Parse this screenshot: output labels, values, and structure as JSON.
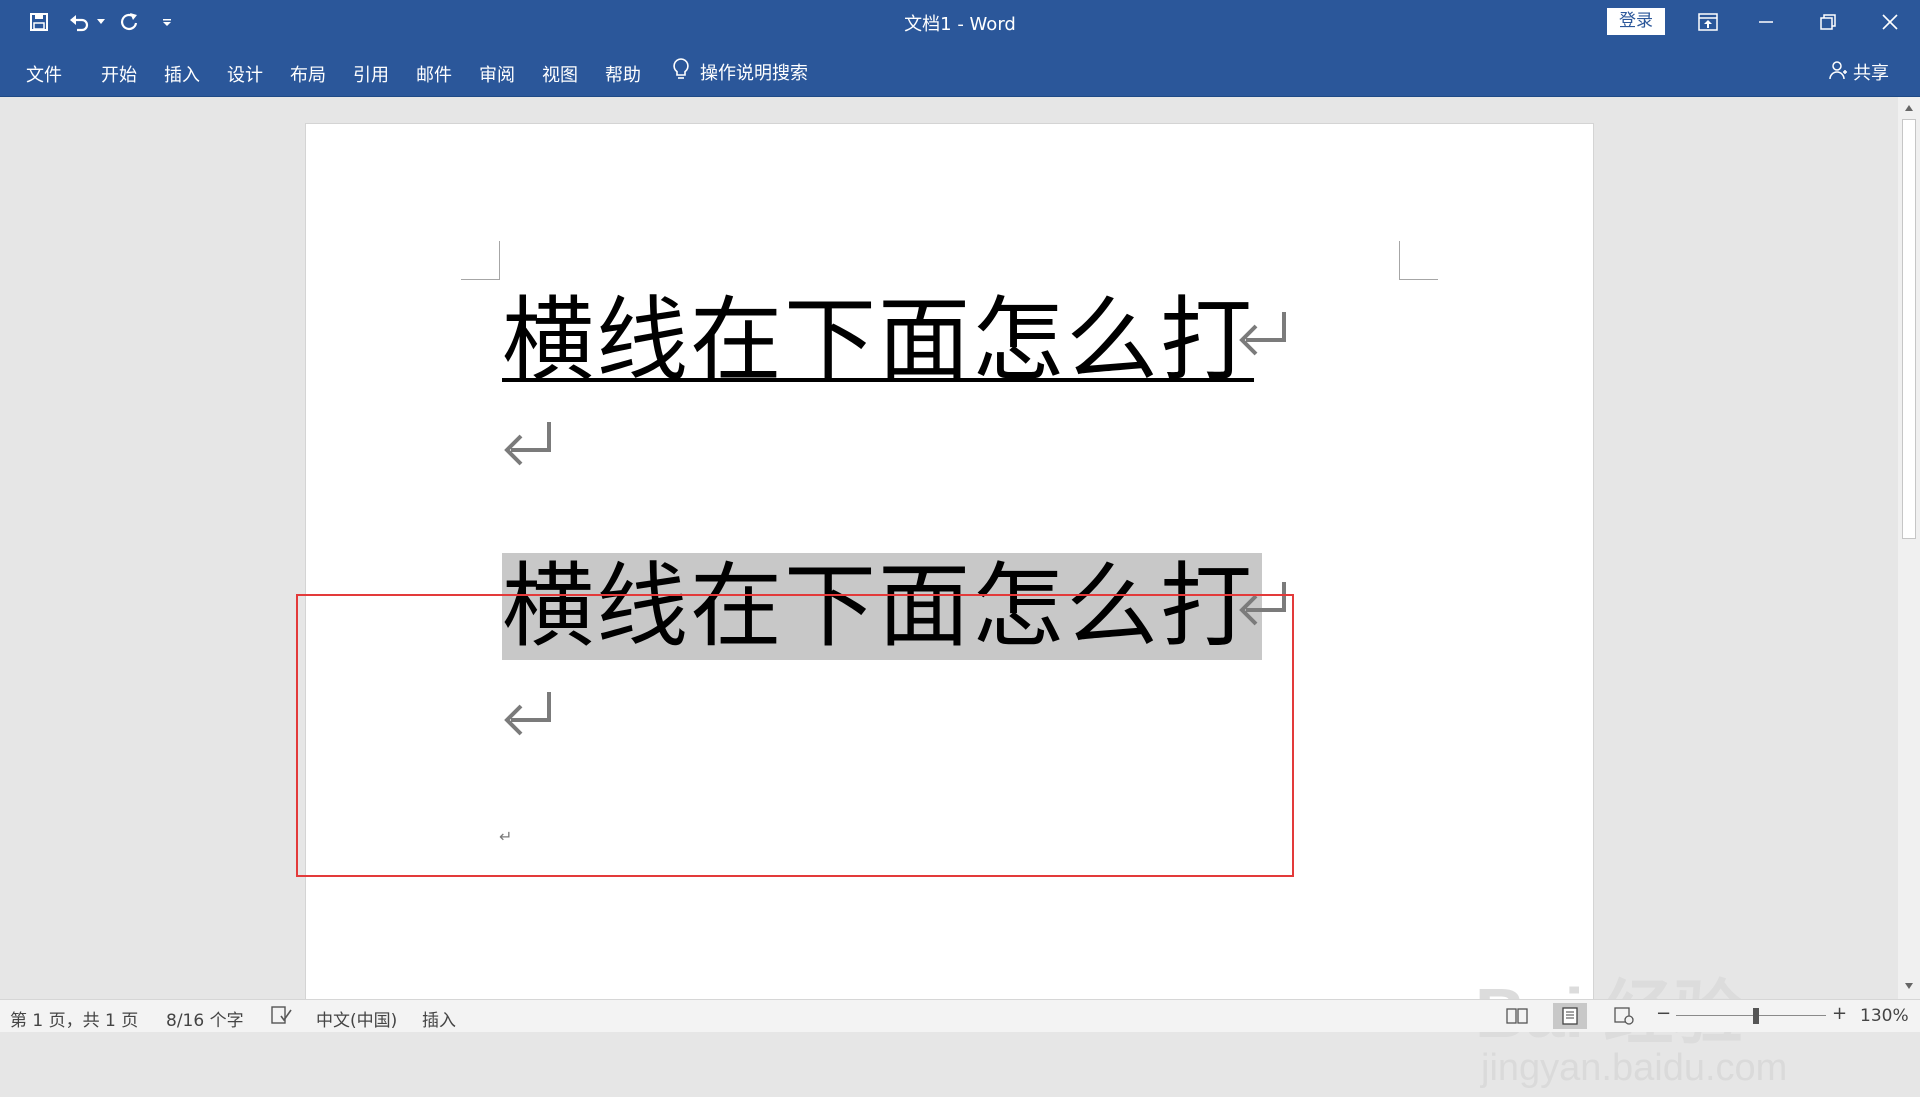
{
  "window": {
    "title": "文档1  -  Word",
    "login_label": "登录"
  },
  "ribbon": {
    "tabs": [
      "文件",
      "开始",
      "插入",
      "设计",
      "布局",
      "引用",
      "邮件",
      "审阅",
      "视图",
      "帮助"
    ],
    "tell_me": "操作说明搜索",
    "share": "共享"
  },
  "document": {
    "line1": "横线在下面怎么打",
    "line2": "横线在下面怎么打",
    "paragraph_mark": "↵"
  },
  "watermark": {
    "main": "Bai 经验",
    "sub": "jingyan.baidu.com"
  },
  "status": {
    "page": "第 1 页，共 1 页",
    "words": "8/16 个字",
    "language": "中文(中国)",
    "mode": "插入",
    "zoom": "130%",
    "zoom_minus": "−",
    "zoom_plus": "+"
  },
  "colors": {
    "accent": "#2b579a",
    "highlight": "#c8c8c8",
    "callout": "#e33a3a"
  }
}
